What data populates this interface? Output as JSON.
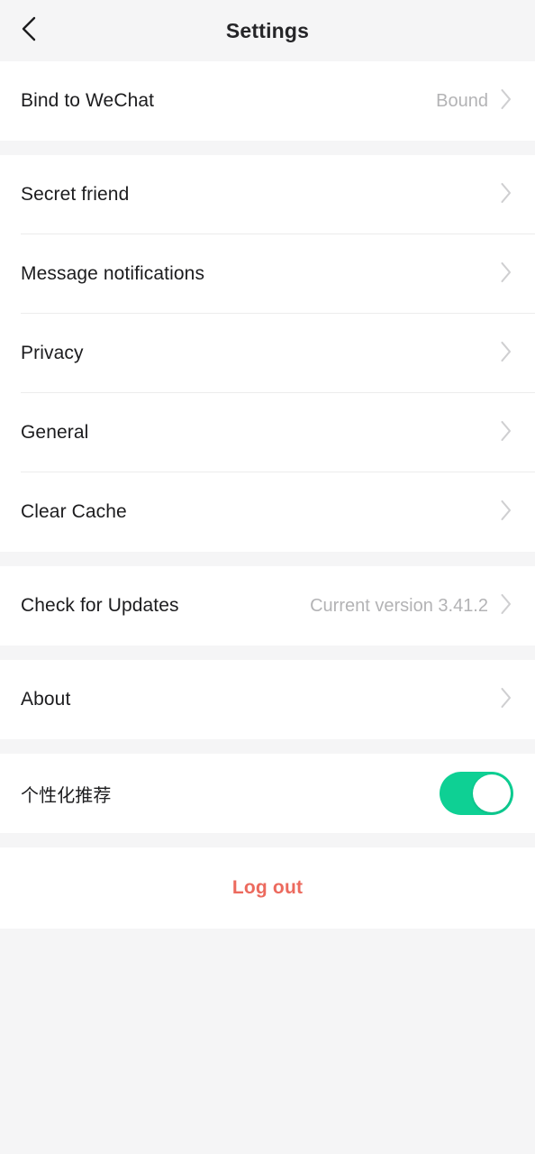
{
  "header": {
    "title": "Settings",
    "back_icon": "chevron-left-icon"
  },
  "colors": {
    "page_background": "#F5F5F6",
    "card_background": "#FFFFFF",
    "primary_text": "#1C1C1E",
    "secondary_text": "#B3B3B5",
    "separator": "#ECECEC",
    "toggle_on": "#0ED094",
    "logout_red": "#EC6A5E",
    "chevron_gray": "#CFCFD1"
  },
  "groups": [
    {
      "name": "account",
      "rows": [
        {
          "label": "Bind to WeChat",
          "value": "Bound",
          "accessory": "chevron-right-icon"
        }
      ]
    },
    {
      "name": "preferences",
      "rows": [
        {
          "label": "Secret friend",
          "value": "",
          "accessory": "chevron-right-icon"
        },
        {
          "label": "Message notifications",
          "value": "",
          "accessory": "chevron-right-icon"
        },
        {
          "label": "Privacy",
          "value": "",
          "accessory": "chevron-right-icon"
        },
        {
          "label": "General",
          "value": "",
          "accessory": "chevron-right-icon"
        },
        {
          "label": "Clear Cache",
          "value": "",
          "accessory": "chevron-right-icon"
        }
      ]
    },
    {
      "name": "updates",
      "rows": [
        {
          "label": "Check for Updates",
          "value": "Current version 3.41.2",
          "accessory": "chevron-right-icon"
        }
      ]
    },
    {
      "name": "about",
      "rows": [
        {
          "label": "About",
          "value": "",
          "accessory": "chevron-right-icon"
        }
      ]
    },
    {
      "name": "recommendations",
      "rows": [
        {
          "label": "个性化推荐",
          "value": "",
          "accessory": "toggle-switch",
          "toggle_on": true
        }
      ]
    }
  ],
  "logout": {
    "label": "Log out"
  }
}
